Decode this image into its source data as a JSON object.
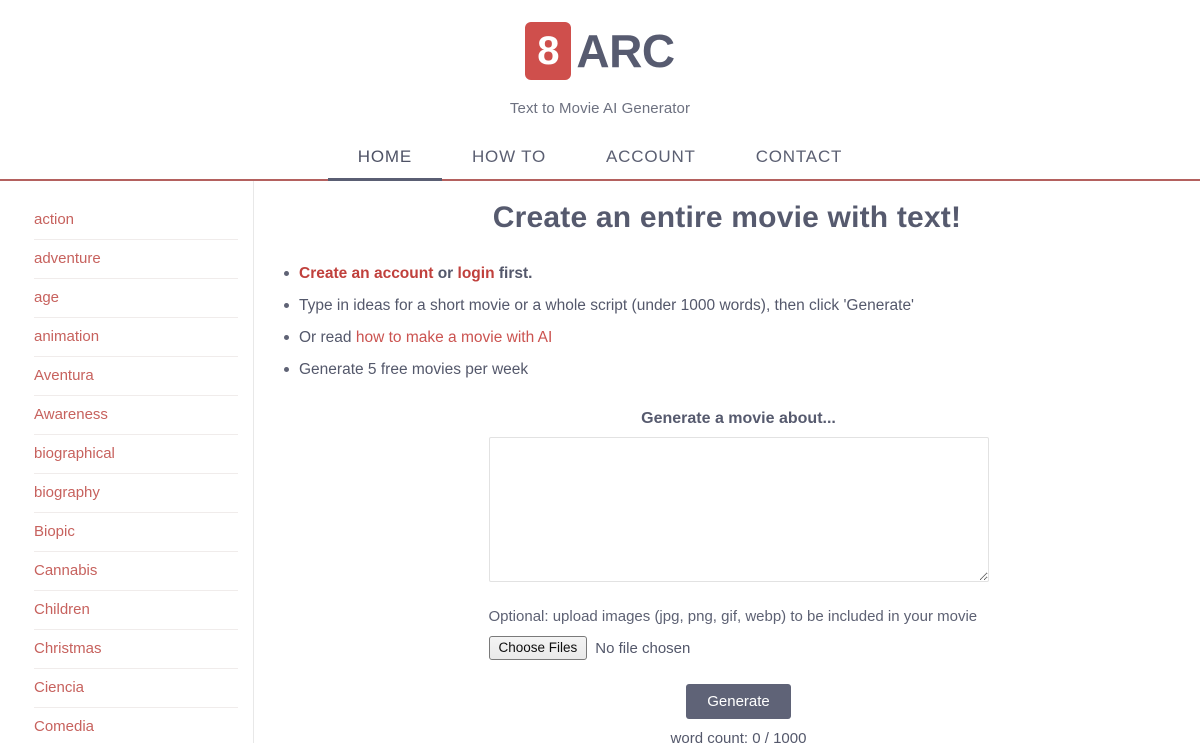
{
  "brand": {
    "logo_mark": "8",
    "logo_word": "ARC",
    "tagline": "Text to Movie AI Generator",
    "accent_red": "#cf4f4c",
    "slate": "#575b70"
  },
  "nav": {
    "items": [
      {
        "label": "HOME",
        "active": true
      },
      {
        "label": "HOW TO",
        "active": false
      },
      {
        "label": "ACCOUNT",
        "active": false
      },
      {
        "label": "CONTACT",
        "active": false
      }
    ]
  },
  "sidebar": {
    "categories": [
      "action",
      "adventure",
      "age",
      "animation",
      "Aventura",
      "Awareness",
      "biographical",
      "biography",
      "Biopic",
      "Cannabis",
      "Children",
      "Christmas",
      "Ciencia",
      "Comedia"
    ]
  },
  "main": {
    "title": "Create an entire movie with text!",
    "bullets": {
      "b1_link1": "Create an account",
      "b1_mid": " or ",
      "b1_link2": "login",
      "b1_tail": " first.",
      "b2": "Type in ideas for a short movie or a whole script (under 1000 words), then click 'Generate'",
      "b3_lead": "Or read ",
      "b3_link": "how to make a movie with AI",
      "b4": "Generate 5 free movies per week"
    }
  },
  "form": {
    "title": "Generate a movie about...",
    "prompt_value": "",
    "prompt_placeholder": "",
    "upload_note": "Optional: upload images (jpg, png, gif, webp) to be included in your movie",
    "choose_files_label": "Choose Files",
    "file_status": "No file chosen",
    "generate_label": "Generate",
    "word_count": "word count: 0 / 1000"
  }
}
